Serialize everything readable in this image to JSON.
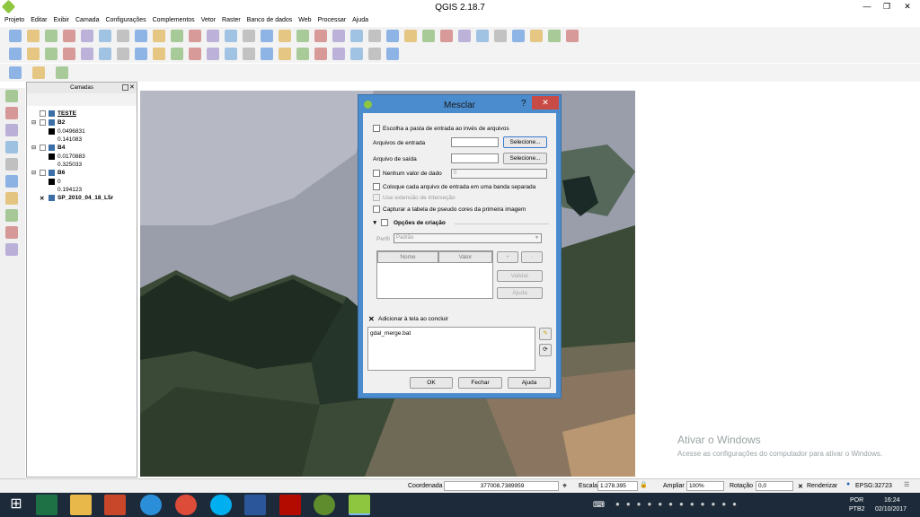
{
  "window": {
    "title": "QGIS 2.18.7",
    "minimize": "—",
    "maximize": "❐",
    "close": "✕"
  },
  "menu": [
    "Projeto",
    "Editar",
    "Exibir",
    "Camada",
    "Configurações",
    "Complementos",
    "Vetor",
    "Raster",
    "Banco de dados",
    "Web",
    "Processar",
    "Ajuda"
  ],
  "layers_panel": {
    "title": "Camadas",
    "items": [
      {
        "name": "TESTE",
        "underline": true
      },
      {
        "name": "B2"
      },
      {
        "value": "0.0496831"
      },
      {
        "value": "0.141083"
      },
      {
        "name": "B4"
      },
      {
        "value": "0.0170883"
      },
      {
        "value": "0.325033"
      },
      {
        "name": "B6"
      },
      {
        "value": "0"
      },
      {
        "value": "0.194123"
      },
      {
        "name": "SP_2010_04_18_L5r",
        "checked": "✕"
      }
    ]
  },
  "dialog": {
    "title": "Mesclar",
    "help": "?",
    "close": "✕",
    "opt_folder": "Escolha a pasta de entrada ao invés de arquivos",
    "input_files_label": "Arquivos de entrada",
    "input_files_value": "",
    "input_select": "Selecione...",
    "output_file_label": "Arquivo de saída",
    "output_file_value": "",
    "output_select": "Selecione...",
    "nodata_label": "Nenhum valor de dado",
    "nodata_value": "0",
    "separate_bands": "Coloque cada arquivo de entrada em uma banda separada",
    "intersection": "Use extensão de interseção",
    "pseudocolor": "Capturar a tabela de pseudo cores da primeira imagem",
    "creation_options": "Opções de criação",
    "profile_label": "Perfil",
    "profile_value": "Padrão",
    "col_name": "Nome",
    "col_value": "Valor",
    "add": "+",
    "remove": "-",
    "validate": "Validar",
    "help_btn": "Ajuda",
    "add_to_canvas": "Adicionar à tela ao concluir",
    "add_to_canvas_mark": "✕",
    "command": "gdal_merge.bat",
    "ok": "OK",
    "close_btn": "Fechar",
    "help_bottom": "Ajuda"
  },
  "watermark": {
    "title": "Ativar o Windows",
    "text": "Acesse as configurações do computador para ativar o Windows."
  },
  "statusbar": {
    "coord_label": "Coordenada",
    "coord_value": "377008,7389959",
    "scale_label": "Escala",
    "scale_value": "1:278.395",
    "zoom_label": "Ampliar",
    "zoom_value": "100%",
    "rotation_label": "Rotação",
    "rotation_value": "0,0",
    "render_label": "Renderizar",
    "render_mark": "✕",
    "epsg": "EPSG:32723"
  },
  "taskbar": {
    "lang": "POR",
    "layout": "PTB2",
    "time": "16:24",
    "date": "02/10/2017"
  },
  "colors": {
    "accent": "#4a8ccd",
    "taskbar": "#1c2a3a"
  }
}
